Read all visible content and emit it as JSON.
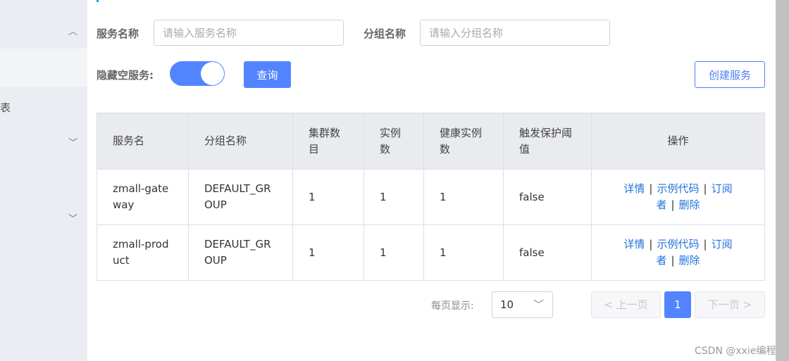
{
  "sidebar": {
    "partial_item": "表"
  },
  "filters": {
    "service_label": "服务名称",
    "service_placeholder": "请输入服务名称",
    "group_label": "分组名称",
    "group_placeholder": "请输入分组名称",
    "hide_empty_label": "隐藏空服务:",
    "hide_empty_on": true,
    "query_label": "查询",
    "create_label": "创建服务"
  },
  "table": {
    "headers": [
      "服务名",
      "分组名称",
      "集群数目",
      "实例数",
      "健康实例数",
      "触发保护阈值",
      "操作"
    ],
    "rows": [
      {
        "name": "zmall-gateway",
        "group": "DEFAULT_GROUP",
        "clusters": "1",
        "instances": "1",
        "healthy": "1",
        "threshold": "false"
      },
      {
        "name": "zmall-product",
        "group": "DEFAULT_GROUP",
        "clusters": "1",
        "instances": "1",
        "healthy": "1",
        "threshold": "false"
      }
    ],
    "ops": [
      "详情",
      "示例代码",
      "订阅者",
      "删除"
    ]
  },
  "pagination": {
    "per_page_label": "每页显示:",
    "per_page": "10",
    "prev": "上一页",
    "current": "1",
    "next": "下一页"
  },
  "watermark": "CSDN @xxie编程",
  "colors": {
    "primary": "#5384ff",
    "link": "#2372d9"
  }
}
